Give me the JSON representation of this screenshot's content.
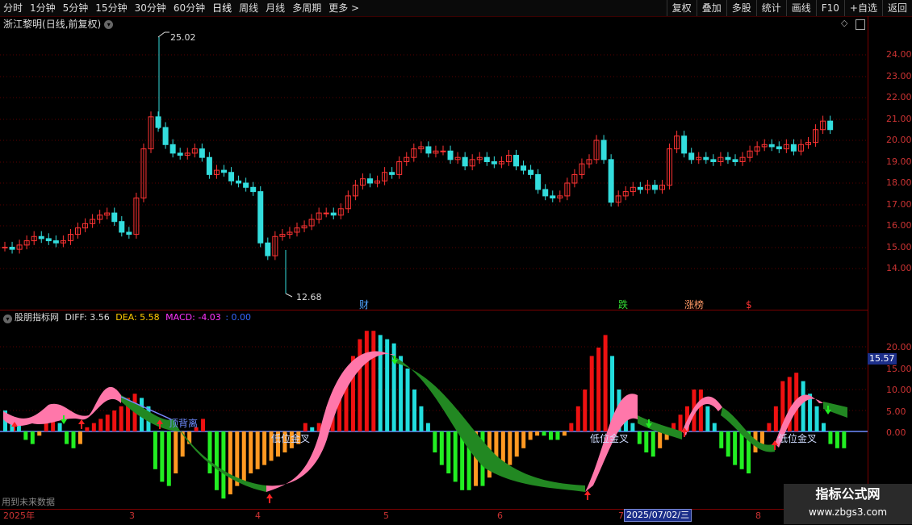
{
  "toolbar": {
    "periods": [
      "分时",
      "1分钟",
      "5分钟",
      "15分钟",
      "30分钟",
      "60分钟",
      "日线",
      "周线",
      "月线",
      "多周期",
      "更多 >"
    ],
    "active_period": "日线",
    "tools": [
      "复权",
      "叠加",
      "多股",
      "统计",
      "画线",
      "F10",
      "+自选",
      "返回"
    ]
  },
  "main_chart": {
    "stock_name": "浙江黎明",
    "period_label": "(日线,前复权)",
    "high_label": "25.02",
    "low_label": "12.68",
    "price_ticks": [
      "24.00",
      "23.00",
      "22.00",
      "21.00",
      "20.00",
      "19.00",
      "18.00",
      "17.00",
      "16.00",
      "15.00",
      "14.00"
    ],
    "event_markers": [
      {
        "text": "财",
        "color": "#4fa3ff"
      },
      {
        "text": "跌",
        "color": "#33dd33"
      },
      {
        "text": "涨榜",
        "color": "#ff9966"
      },
      {
        "text": "$",
        "color": "#ff3333"
      }
    ]
  },
  "indicator": {
    "name": "股朋指标网",
    "diff_label": "DIFF: 3.56",
    "dea_label": "DEA: 5.58",
    "macd_label": "MACD: -4.03",
    "extra_label": ": 0.00",
    "colors": {
      "diff": "#dddddd",
      "dea": "#ffcc00",
      "macd": "#ff33ff",
      "extra": "#3366ff"
    },
    "ticks": [
      "20.00",
      "15.00",
      "10.00",
      "5.00",
      "0.00"
    ],
    "current_value": "15.57",
    "annotations": [
      "顶背离",
      "低位金叉",
      "低位金叉",
      "低位金叉"
    ]
  },
  "future_text": "用到未来数据",
  "date_axis": {
    "labels": [
      "2025年",
      "3",
      "4",
      "5",
      "6",
      "7",
      "8"
    ],
    "cursor_date": "2025/07/02/三"
  },
  "watermark": {
    "line1": "指标公式网",
    "line2": "www.zbgs3.com"
  }
}
